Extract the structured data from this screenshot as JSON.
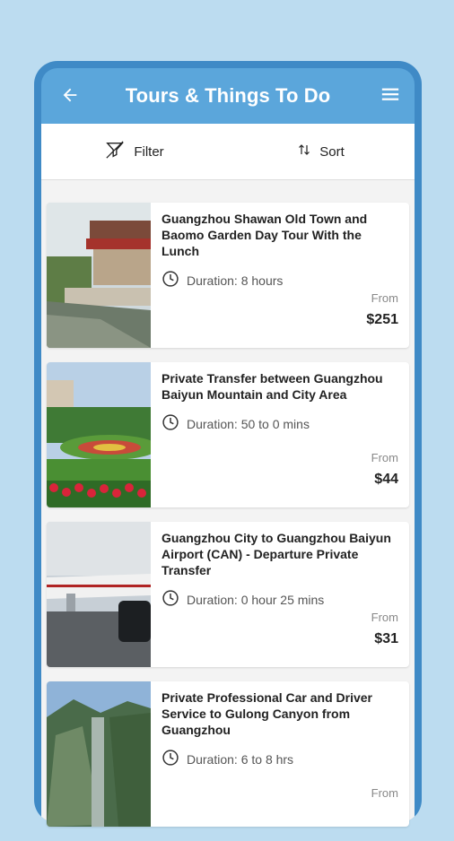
{
  "header": {
    "title": "Tours & Things To Do"
  },
  "toolbar": {
    "filter_label": "Filter",
    "sort_label": "Sort"
  },
  "tours": [
    {
      "title": "Guangzhou Shawan Old Town and Baomo Garden Day Tour With the Lunch",
      "duration": "Duration: 8 hours",
      "from_label": "From",
      "price": "$251"
    },
    {
      "title": "Private Transfer between Guangzhou Baiyun Mountain and City Area",
      "duration": "Duration: 50 to 0 mins",
      "from_label": "From",
      "price": "$44"
    },
    {
      "title": "Guangzhou City to Guangzhou Baiyun Airport (CAN) - Departure Private Transfer",
      "duration": "Duration: 0 hour 25 mins",
      "from_label": "From",
      "price": "$31"
    },
    {
      "title": "Private Professional Car and Driver Service to Gulong Canyon from Guangzhou",
      "duration": "Duration: 6 to 8 hrs",
      "from_label": "From",
      "price": ""
    }
  ],
  "colors": {
    "background": "#bcdcf0",
    "frame": "#3f8ac6",
    "appbar": "#5ba6db"
  },
  "icons": [
    "back-arrow-icon",
    "menu-icon",
    "filter-icon",
    "sort-icon",
    "clock-icon"
  ]
}
